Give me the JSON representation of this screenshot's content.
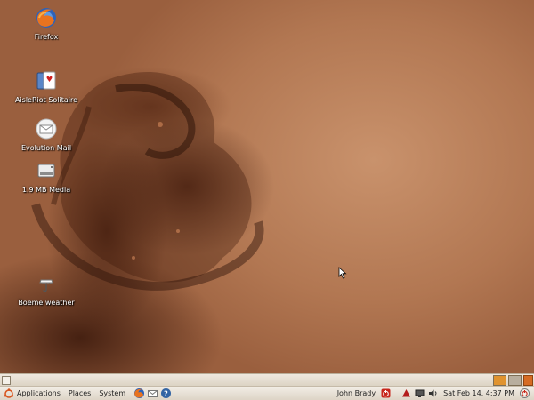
{
  "desktop": {
    "icons": [
      {
        "label": "Firefox",
        "icon": "firefox-icon"
      },
      {
        "label": "AisleRiot Solitaire",
        "icon": "solitaire-cards-icon"
      },
      {
        "label": "Evolution Mail",
        "icon": "mail-envelope-icon"
      },
      {
        "label": "1.9 MB Media",
        "icon": "floppy-drive-icon"
      },
      {
        "label": "Boeme weather",
        "icon": "weather-icon"
      }
    ]
  },
  "panel": {
    "menus": {
      "applications": "Applications",
      "places": "Places",
      "system": "System"
    },
    "launchers": [
      "firefox-icon",
      "mail-icon",
      "help-icon"
    ],
    "user_name": "John Brady",
    "clock": "Sat Feb 14,  4:37 PM"
  },
  "colors": {
    "panel_bg": "#e8e2d8",
    "accent_orange": "#e0932f",
    "shutdown_red": "#c8261c"
  }
}
